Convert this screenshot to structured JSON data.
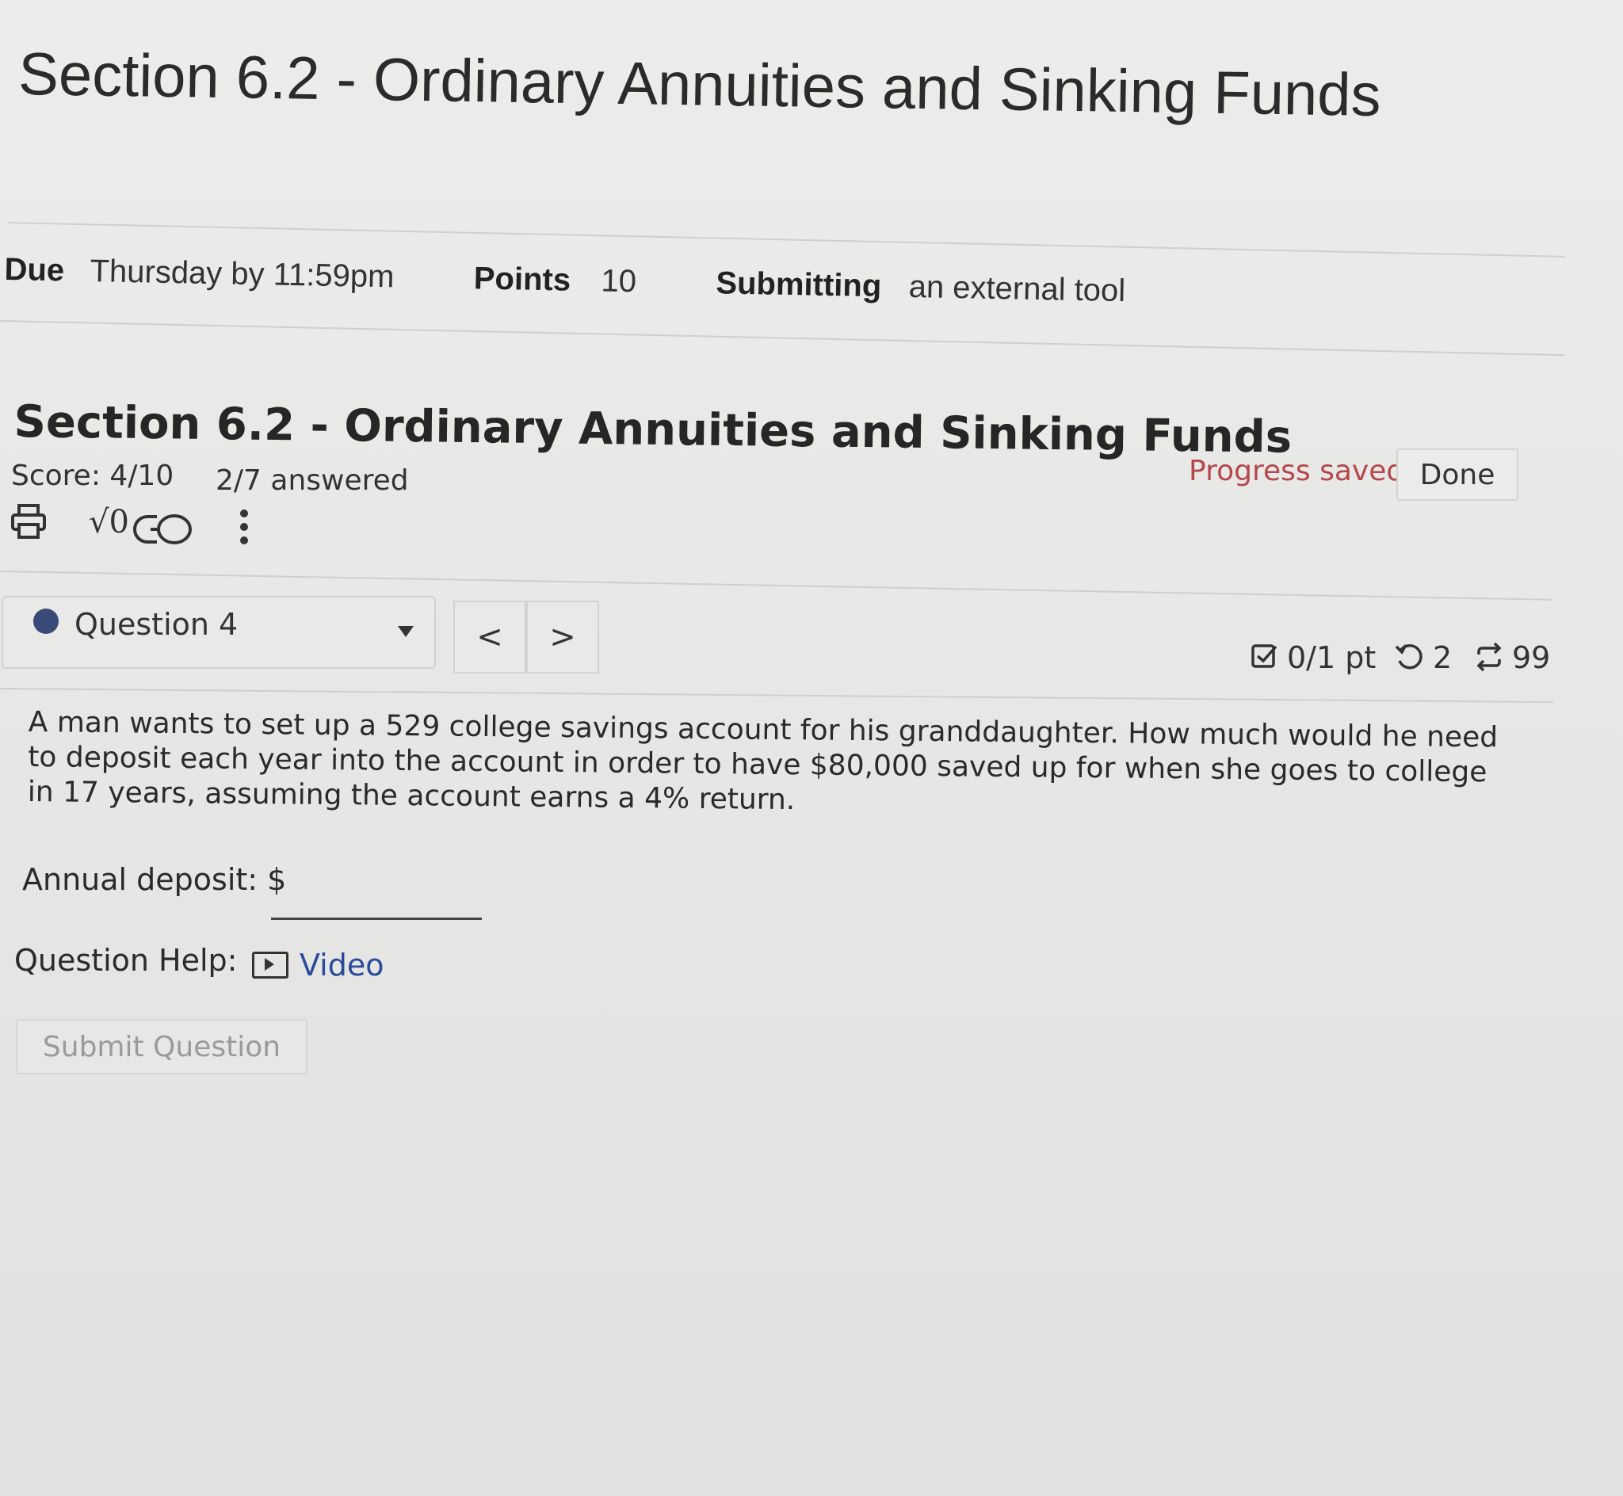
{
  "page": {
    "title": "Section 6.2 - Ordinary Annuities and Sinking Funds"
  },
  "meta": {
    "due_label": "Due",
    "due_value": "Thursday by 11:59pm",
    "points_label": "Points",
    "points_value": "10",
    "submitting_label": "Submitting",
    "submitting_value": "an external tool"
  },
  "quiz": {
    "title": "Section 6.2 - Ordinary Annuities and Sinking Funds",
    "score": "Score: 4/10",
    "answered": "2/7 answered",
    "progress_status": "Progress saved",
    "done_label": "Done",
    "status_color": "#b5484c",
    "toolbar": {
      "print_icon": "printer-icon",
      "math_icon": "sqrt-zero-icon",
      "link_icon": "chain-link-icon",
      "more_icon": "vertical-ellipsis-icon",
      "math_glyph": "√0"
    }
  },
  "question": {
    "selector_label": "Question 4",
    "prev_glyph": "<",
    "next_glyph": ">",
    "points": "0/1 pt",
    "retries": "2",
    "attempts": "99",
    "text": "A man wants to set up a 529 college savings account for his granddaughter. How much would he need to deposit each year into the account in order to have $80,000 saved up for when she goes to college in 17 years, assuming the account earns a 4% return.",
    "answer_label": "Annual deposit: $",
    "answer_value": "",
    "help_label": "Question Help:",
    "video_label": "Video",
    "submit_label": "Submit Question",
    "link_color": "#2a4a9a"
  }
}
